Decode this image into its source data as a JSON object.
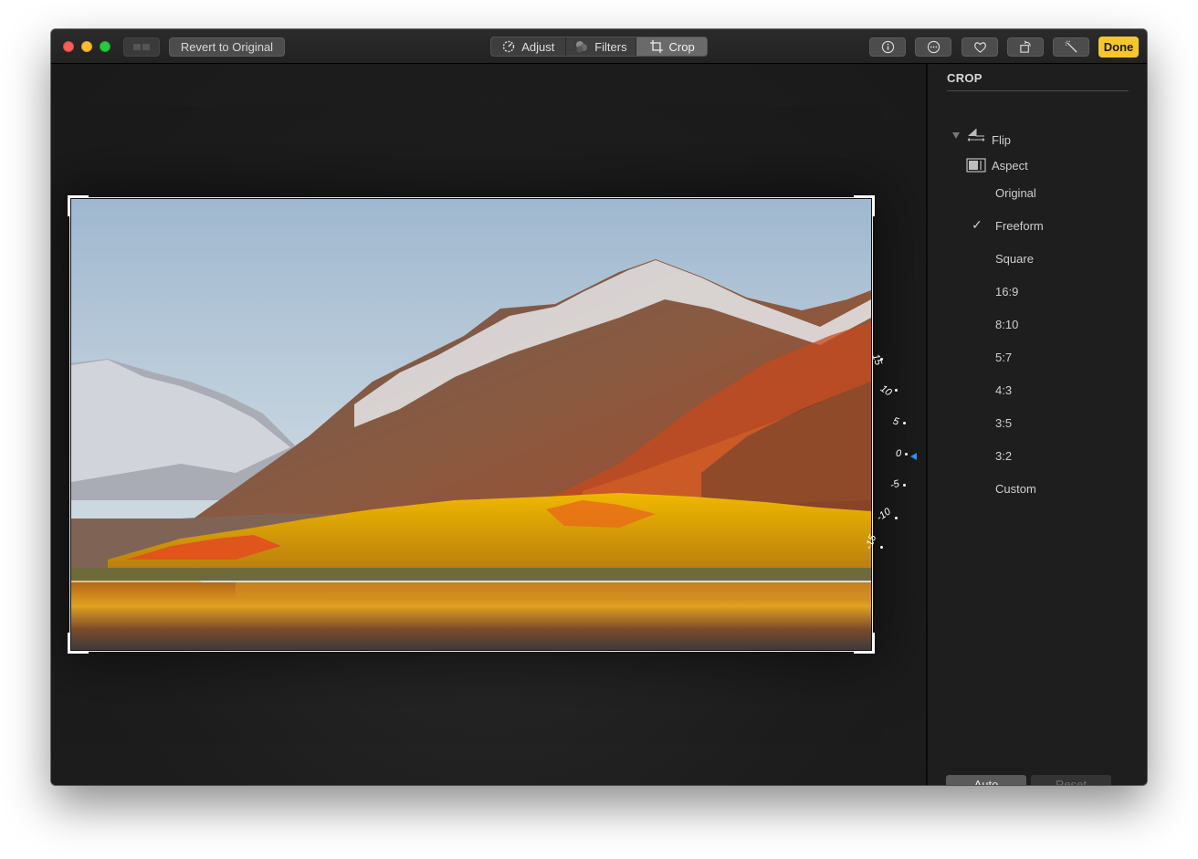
{
  "toolbar": {
    "revert_label": "Revert to Original",
    "tabs": [
      {
        "label": "Adjust",
        "icon": "adjust-dial-icon"
      },
      {
        "label": "Filters",
        "icon": "filters-circles-icon"
      },
      {
        "label": "Crop",
        "icon": "crop-icon"
      }
    ],
    "selected_tab": "Crop",
    "icon_buttons": [
      "info-icon",
      "more-icon",
      "heart-icon",
      "rotate-icon",
      "magic-wand-icon"
    ],
    "done_label": "Done",
    "done_color": "#f7c62f"
  },
  "straighten_dial": {
    "labels": [
      "15",
      "10",
      "5",
      "0",
      "-5",
      "-10",
      "-15"
    ],
    "current": "0",
    "indicator_color": "#2f8cf4"
  },
  "crop_panel": {
    "title": "CROP",
    "flip_label": "Flip",
    "aspect_label": "Aspect",
    "aspect_options": [
      "Original",
      "Freeform",
      "Square",
      "16:9",
      "8:10",
      "5:7",
      "4:3",
      "3:5",
      "3:2",
      "Custom"
    ],
    "selected_aspect": "Freeform",
    "auto_label": "Auto",
    "reset_label": "Reset"
  }
}
